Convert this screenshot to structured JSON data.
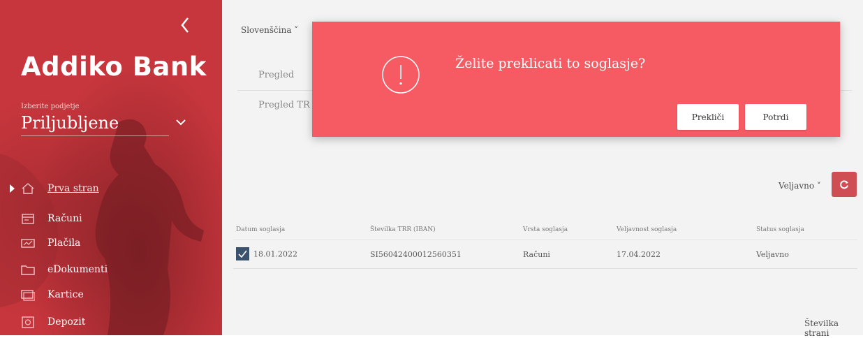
{
  "sidebar": {
    "brand": "Addiko Bank",
    "select_label": "Izberite podjetje",
    "select_value": "Priljubljene",
    "items": [
      {
        "label": "Prva stran",
        "icon": "home-icon",
        "active": true
      },
      {
        "label": "Računi",
        "icon": "accounts-icon"
      },
      {
        "label": "Plačila",
        "icon": "payments-icon"
      },
      {
        "label": "eDokumenti",
        "icon": "folder-icon"
      },
      {
        "label": "Kartice",
        "icon": "card-icon"
      },
      {
        "label": "Depozit",
        "icon": "deposit-icon"
      }
    ]
  },
  "header": {
    "language": "Slovenščina ˅"
  },
  "tabs": {
    "overview": "Pregled",
    "overview_trr": "Pregled TR"
  },
  "filter": {
    "status": "Veljavno ˅"
  },
  "table": {
    "columns": [
      "Datum soglasja",
      "Številka TRR (IBAN)",
      "Vrsta soglasja",
      "Veljavnost soglasja",
      "Status soglasja"
    ],
    "rows": [
      {
        "date": "18.01.2022",
        "iban": "SI56042400012560351",
        "type": "Računi",
        "validity": "17.04.2022",
        "status": "Veljavno"
      }
    ]
  },
  "pager": {
    "label": "Številka strani"
  },
  "modal": {
    "question": "Želite preklicati to soglasje?",
    "cancel_label": "Prekliči",
    "confirm_label": "Potrdi",
    "icon": "exclamation-icon"
  },
  "colors": {
    "brand_red": "#c8363d",
    "modal_bg": "#f65a63",
    "checkbox": "#1f3b57"
  }
}
